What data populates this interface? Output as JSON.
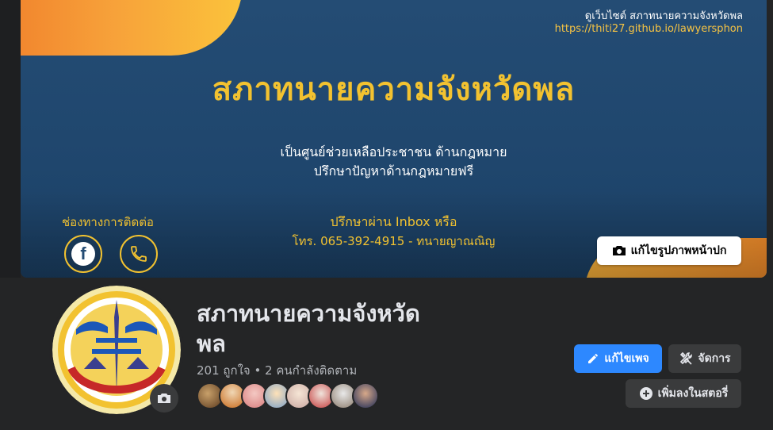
{
  "cover": {
    "site_label": "ดูเว็บไซต์ สภาทนายความจังหวัดพล",
    "site_url": "https://thiti27.github.io/lawyersphon",
    "title": "สภาทนายความจังหวัดพล",
    "subtitle_line1": "เป็นศูนย์ช่วยเหลือประชาชน ด้านกฎหมาย",
    "subtitle_line2": "ปรึกษาปัญหาด้านกฎหมายฟรี",
    "contact_label": "ช่องทางการติดต่อ",
    "inbox_line1": "ปรึกษาผ่าน Inbox หรือ",
    "inbox_line2": "โทร. 065-392-4915  - ทนายญาณณิญ",
    "edit_cover_label": "แก้ไขรูปภาพหน้าปก",
    "accent_color": "#f2c230",
    "bg_color": "#244c74",
    "icons": [
      "facebook-icon",
      "phone-icon",
      "camera-icon"
    ]
  },
  "page": {
    "name": "สภาทนายความจังหวัดพล",
    "name_line1": "สภาทนายความจังหวัด",
    "name_line2": "พล",
    "stats": "201 ถูกใจ • 2 คนกำลังติดตาม",
    "follower_count_shown": 8
  },
  "actions": {
    "edit_page": "แก้ไขเพจ",
    "manage": "จัดการ",
    "add_story": "เพิ่มลงในสตอรี่",
    "primary_color": "#2d88ff"
  }
}
